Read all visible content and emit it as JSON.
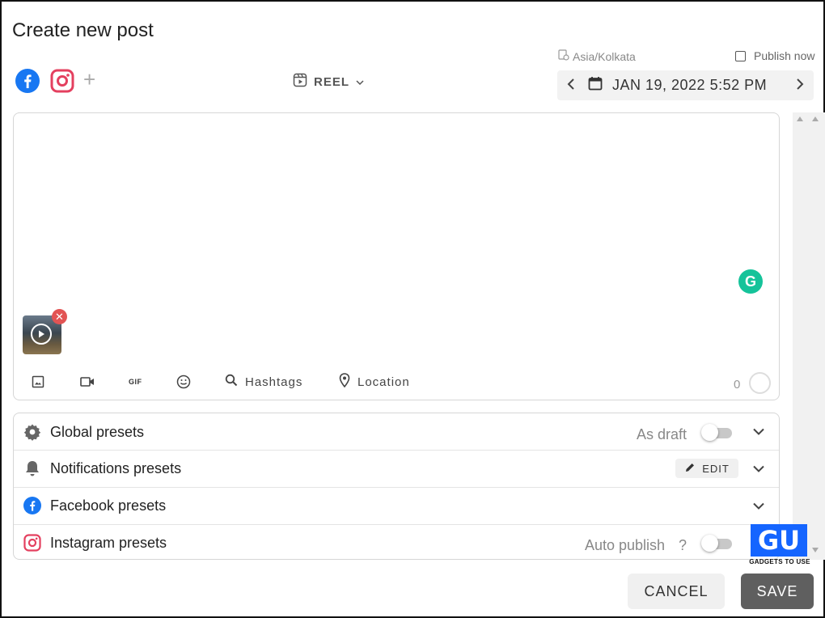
{
  "dialog": {
    "title": "Create new post"
  },
  "networks": {
    "items": [
      {
        "name": "facebook-icon",
        "color": "#1877f2"
      },
      {
        "name": "instagram-icon",
        "color": "#e4405f"
      }
    ],
    "add_icon": "plus-icon"
  },
  "post_type": {
    "label": "REEL",
    "icon": "reel-icon"
  },
  "schedule": {
    "timezone": "Asia/Kolkata",
    "publish_now_label": "Publish now",
    "publish_now_checked": false,
    "datetime": "JAN 19, 2022 5:52 PM"
  },
  "editor": {
    "text": "",
    "attachment": {
      "type": "video",
      "remove_icon": "close-icon"
    },
    "grammarly_letter": "G",
    "character_count": "0",
    "toolbar": {
      "image_icon": "image-icon",
      "video_icon": "video-icon",
      "gif_label": "GIF",
      "emoji_icon": "emoji-icon",
      "hashtags_label": "Hashtags",
      "location_label": "Location"
    }
  },
  "presets": {
    "global": {
      "label": "Global presets",
      "side_label": "As draft",
      "toggle_on": false
    },
    "notifications": {
      "label": "Notifications presets",
      "edit_label": "EDIT"
    },
    "facebook": {
      "label": "Facebook presets"
    },
    "instagram": {
      "label": "Instagram presets",
      "side_label": "Auto publish",
      "help": "?",
      "toggle_on": false
    }
  },
  "watermark": {
    "text": "GADGETS TO USE"
  },
  "actions": {
    "cancel_label": "CANCEL",
    "save_label": "SAVE"
  },
  "colors": {
    "accent": "#1877f2",
    "instagram": "#e4405f",
    "grammarly": "#15c39a",
    "save_bg": "#5f5f5f"
  }
}
